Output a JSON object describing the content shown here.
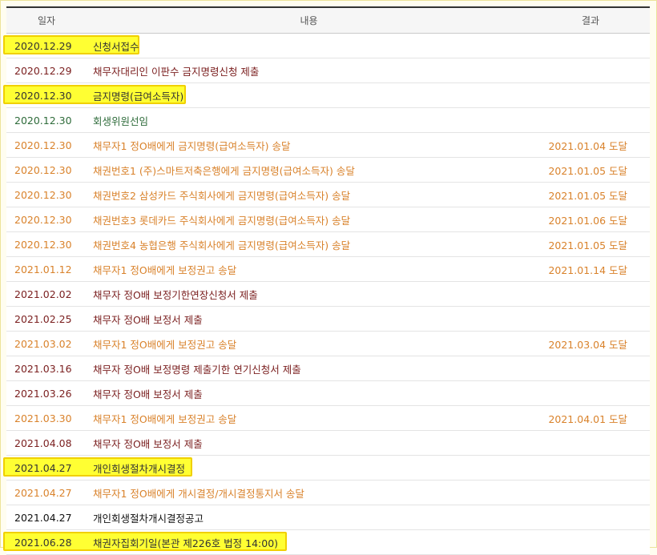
{
  "headers": {
    "date": "일자",
    "content": "내용",
    "result": "결과"
  },
  "rows": [
    {
      "date": "2020.12.29",
      "content": "신청서접수",
      "result": "",
      "style": "black",
      "highlight": true
    },
    {
      "date": "2020.12.29",
      "content": "채무자대리인 이판수 금지명령신청 제출",
      "result": "",
      "style": "red",
      "highlight": false
    },
    {
      "date": "2020.12.30",
      "content": "금지명령(급여소득자)",
      "result": "",
      "style": "black",
      "highlight": true
    },
    {
      "date": "2020.12.30",
      "content": "회생위원선임",
      "result": "",
      "style": "green",
      "highlight": false
    },
    {
      "date": "2020.12.30",
      "content": "채무자1 정O배에게 금지명령(급여소득자) 송달",
      "result": "2021.01.04 도달",
      "style": "orange",
      "highlight": false
    },
    {
      "date": "2020.12.30",
      "content": "채권번호1 (주)스마트저축은행에게 금지명령(급여소득자) 송달",
      "result": "2021.01.05 도달",
      "style": "orange",
      "highlight": false
    },
    {
      "date": "2020.12.30",
      "content": "채권번호2 삼성카드 주식회사에게 금지명령(급여소득자) 송달",
      "result": "2021.01.05 도달",
      "style": "orange",
      "highlight": false
    },
    {
      "date": "2020.12.30",
      "content": "채권번호3 롯데카드 주식회사에게 금지명령(급여소득자) 송달",
      "result": "2021.01.06 도달",
      "style": "orange",
      "highlight": false
    },
    {
      "date": "2020.12.30",
      "content": "채권번호4 농협은행 주식회사에게 금지명령(급여소득자) 송달",
      "result": "2021.01.05 도달",
      "style": "orange",
      "highlight": false
    },
    {
      "date": "2021.01.12",
      "content": "채무자1 정O배에게 보정권고 송달",
      "result": "2021.01.14 도달",
      "style": "orange",
      "highlight": false
    },
    {
      "date": "2021.02.02",
      "content": "채무자 정O배 보정기한연장신청서 제출",
      "result": "",
      "style": "red",
      "highlight": false
    },
    {
      "date": "2021.02.25",
      "content": "채무자 정O배 보정서 제출",
      "result": "",
      "style": "red",
      "highlight": false
    },
    {
      "date": "2021.03.02",
      "content": "채무자1 정O배에게 보정권고 송달",
      "result": "2021.03.04 도달",
      "style": "orange",
      "highlight": false
    },
    {
      "date": "2021.03.16",
      "content": "채무자 정O배 보정명령 제출기한 연기신청서 제출",
      "result": "",
      "style": "red",
      "highlight": false
    },
    {
      "date": "2021.03.26",
      "content": "채무자 정O배 보정서 제출",
      "result": "",
      "style": "red",
      "highlight": false
    },
    {
      "date": "2021.03.30",
      "content": "채무자1 정O배에게 보정권고 송달",
      "result": "2021.04.01 도달",
      "style": "orange",
      "highlight": false
    },
    {
      "date": "2021.04.08",
      "content": "채무자 정O배 보정서 제출",
      "result": "",
      "style": "red",
      "highlight": false
    },
    {
      "date": "2021.04.27",
      "content": "개인회생절차개시결정",
      "result": "",
      "style": "black",
      "highlight": true
    },
    {
      "date": "2021.04.27",
      "content": "채무자1 정O배에게 개시결정/개시결정통지서 송달",
      "result": "",
      "style": "orange",
      "highlight": false
    },
    {
      "date": "2021.04.27",
      "content": "개인회생절차개시결정공고",
      "result": "",
      "style": "blackbold",
      "highlight": false
    },
    {
      "date": "2021.06.28",
      "content": "채권자집회기일(본관 제226호 법정 14:00)",
      "result": "",
      "style": "black",
      "highlight": true
    }
  ],
  "colors": {
    "highlight": "#ffff33",
    "highlight_border": "#f0d000",
    "red": "#7a1e1e",
    "orange": "#d9822b",
    "green": "#2e6b3a",
    "black": "#333333"
  }
}
